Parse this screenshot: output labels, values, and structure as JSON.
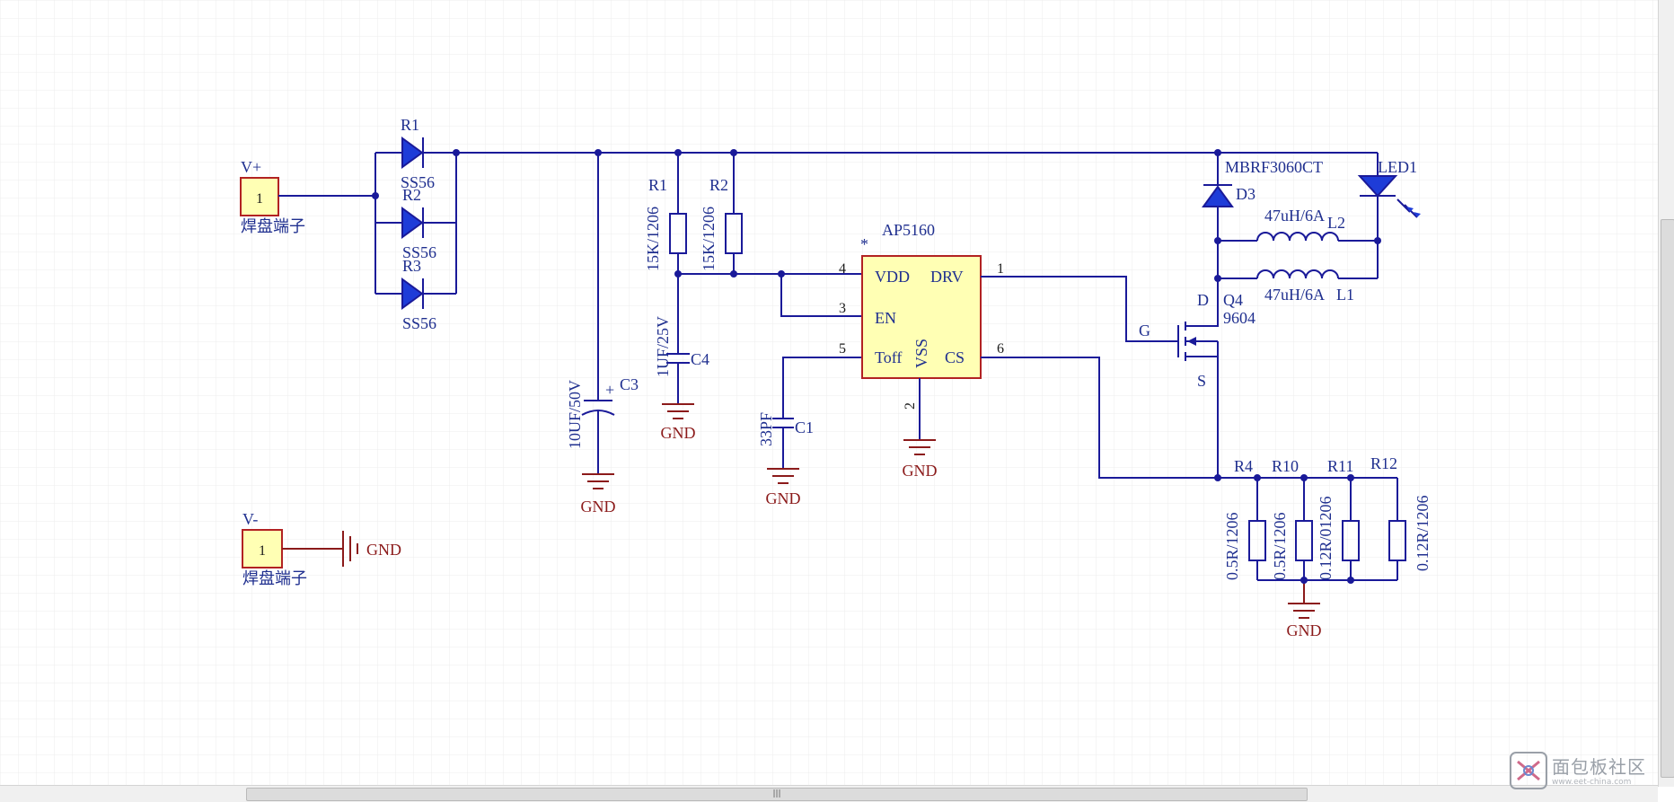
{
  "connectors": {
    "vplus": {
      "name": "V+",
      "pin": "1",
      "desc": "焊盘端子"
    },
    "vminus": {
      "name": "V-",
      "pin": "1",
      "desc": "焊盘端子"
    }
  },
  "diodes": {
    "d1": {
      "ref": "R1",
      "value": "SS56"
    },
    "d2": {
      "ref": "R2",
      "value": "SS56"
    },
    "d3": {
      "ref": "R3",
      "value": "SS56"
    }
  },
  "caps": {
    "c3": {
      "ref": "C3",
      "value": "10UF/50V",
      "polarity": "+"
    },
    "c4": {
      "ref": "C4",
      "value": "1UF/25V"
    },
    "c1": {
      "ref": "C1",
      "value": "33PF"
    }
  },
  "resistors": {
    "r1": {
      "ref": "R1",
      "value": "15K/1206"
    },
    "r2": {
      "ref": "R2",
      "value": "15K/1206"
    },
    "r4": {
      "ref": "R4",
      "value": "0.5R/1206"
    },
    "r10": {
      "ref": "R10",
      "value": "0.5R/1206"
    },
    "r11": {
      "ref": "R11",
      "value": "0.12R/01206"
    },
    "r12": {
      "ref": "R12",
      "value": "0.12R/1206"
    }
  },
  "ic": {
    "ref": "AP5160",
    "marker": "*",
    "pins": {
      "vdd": {
        "num": "4",
        "name": "VDD"
      },
      "en": {
        "num": "3",
        "name": "EN"
      },
      "toff": {
        "num": "5",
        "name": "Toff"
      },
      "drv": {
        "num": "1",
        "name": "DRV"
      },
      "cs": {
        "num": "6",
        "name": "CS"
      },
      "vss": {
        "num": "2",
        "name": "VSS"
      }
    }
  },
  "schottky": {
    "ref": "D3",
    "value": "MBRF3060CT"
  },
  "led": {
    "ref": "LED1"
  },
  "inductors": {
    "l2": {
      "ref": "L2",
      "value": "47uH/6A"
    },
    "l1": {
      "ref": "L1",
      "value": "47uH/6A"
    }
  },
  "mosfet": {
    "ref": "Q4",
    "value": "9604",
    "gate": "G",
    "drain": "D",
    "source": "S"
  },
  "gnd_label": "GND",
  "scrollbar": {
    "grip": "|||"
  },
  "watermark": {
    "title": "面包板社区",
    "sub": "www.eet-china.com"
  },
  "colors": {
    "wire": "#1a1a99",
    "ground": "#8b1a1a",
    "diode_fill": "#1e3cd8",
    "component_fill": "#ffffb4",
    "component_border": "#b22222",
    "grid": "#e8e8e8"
  }
}
